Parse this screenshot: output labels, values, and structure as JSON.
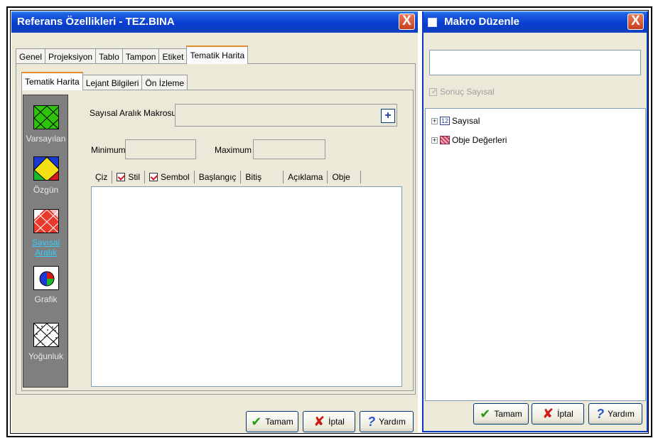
{
  "ref_window": {
    "title": "Referans Özellikleri - TEZ.BINA",
    "close_glyph": "X",
    "tabs": [
      "Genel",
      "Projeksiyon",
      "Tablo",
      "Tampon",
      "Etiket",
      "Tematik Harita"
    ],
    "active_tab": "Tematik Harita",
    "subtabs": [
      "Tematik Harita",
      "Lejant Bilgileri",
      "Ön İzleme"
    ],
    "active_subtab": "Tematik Harita",
    "side_items": [
      {
        "label": "Varsayılan",
        "icon": "varsayilan-icon"
      },
      {
        "label": "Özgün",
        "icon": "ozgun-icon"
      },
      {
        "label": "Sayısal Aralık",
        "icon": "sayisal-aralik-icon",
        "selected": true
      },
      {
        "label": "Grafik",
        "icon": "pie-chart-icon"
      },
      {
        "label": "Yoğunluk",
        "icon": "yogunluk-icon"
      }
    ],
    "macro_label": "Sayısal Aralık Makrosu",
    "macro_value": "",
    "plus_glyph": "+",
    "minimum_label": "Minimum",
    "minimum_value": "",
    "maximum_label": "Maximum",
    "maximum_value": "",
    "columns": [
      "Çiz",
      "Stil",
      "Sembol",
      "Başlangıç",
      "Bitiş",
      "Açıklama",
      "Obje"
    ],
    "buttons": {
      "ok": "Tamam",
      "cancel": "İptal",
      "help": "Yardım"
    }
  },
  "macro_window": {
    "title": "Makro Düzenle",
    "close_glyph": "X",
    "input_value": "",
    "checkbox_label": "Sonuç Sayısal",
    "checkbox_checked": true,
    "tree": [
      {
        "label": "Sayısal",
        "icon_text": "12",
        "expander": "+"
      },
      {
        "label": "Obje Değerleri",
        "expander": "+"
      }
    ],
    "buttons": {
      "ok": "Tamam",
      "cancel": "İptal",
      "help": "Yardım"
    }
  },
  "colors": {
    "title_blue": "#0a3fd0",
    "panel_bg": "#ece9d8",
    "sidebar_gray": "#7f7f7f",
    "selected_link": "#33ccff",
    "close_red": "#c93f1c"
  }
}
